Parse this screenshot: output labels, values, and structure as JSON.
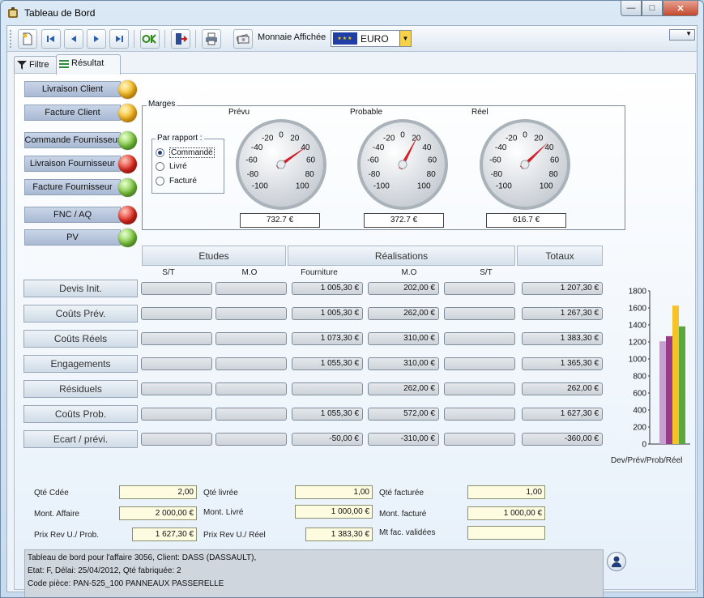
{
  "window": {
    "title": "Tableau de Bord"
  },
  "toolbar": {
    "monnaie_label": "Monnaie Affichée",
    "currency": "EURO",
    "currency_options_icon": "chevron-down-icon"
  },
  "tabs": [
    {
      "label": "Filtre",
      "icon": "filter-icon",
      "active": false
    },
    {
      "label": "Résultat",
      "icon": "list-icon",
      "active": true
    }
  ],
  "status_buttons": [
    {
      "label": "Livraison Client",
      "status": "orange"
    },
    {
      "label": "Facture Client",
      "status": "orange"
    },
    {
      "label": "Commande Fournisseur",
      "status": "green"
    },
    {
      "label": "Livraison Fournisseur",
      "status": "red"
    },
    {
      "label": "Facture Fournisseur",
      "status": "green"
    },
    {
      "label": "FNC / AQ",
      "status": "red"
    },
    {
      "label": "PV",
      "status": "green"
    }
  ],
  "colors": {
    "orange": "#f7b619",
    "green": "#7bc73d",
    "red": "#e1291c",
    "needle": "#d0202a"
  },
  "marges": {
    "title": "Marges",
    "par_rapport_title": "Par rapport :",
    "options": [
      "Commandé",
      "Livré",
      "Facturé"
    ],
    "selected": "Commandé",
    "gauges": [
      {
        "label": "Prévu",
        "value": 732.7,
        "display": "732.7 €"
      },
      {
        "label": "Probable",
        "value": 372.7,
        "display": "372.7 €"
      },
      {
        "label": "Réel",
        "value": 616.7,
        "display": "616.7 €"
      }
    ],
    "scale_labels": [
      "-100",
      "-80",
      "-60",
      "-40",
      "-20",
      "0",
      "20",
      "40",
      "60",
      "80",
      "100"
    ]
  },
  "table": {
    "groups": [
      "Etudes",
      "Réalisations",
      "Totaux"
    ],
    "columns": [
      "S/T",
      "M.O",
      "Fourniture",
      "M.O",
      "S/T"
    ],
    "rows": [
      {
        "label": "Devis Init.",
        "cells": [
          "",
          "",
          "1 005,30 €",
          "202,00 €",
          "",
          "1 207,30 €"
        ]
      },
      {
        "label": "Coûts Prév.",
        "cells": [
          "",
          "",
          "1 005,30 €",
          "262,00 €",
          "",
          "1 267,30 €"
        ]
      },
      {
        "label": "Coûts Réels",
        "cells": [
          "",
          "",
          "1 073,30 €",
          "310,00 €",
          "",
          "1 383,30 €"
        ]
      },
      {
        "label": "Engagements",
        "cells": [
          "",
          "",
          "1 055,30 €",
          "310,00 €",
          "",
          "1 365,30 €"
        ]
      },
      {
        "label": "Résiduels",
        "cells": [
          "",
          "",
          "",
          "262,00 €",
          "",
          "262,00 €"
        ]
      },
      {
        "label": "Coûts Prob.",
        "cells": [
          "",
          "",
          "1 055,30 €",
          "572,00 €",
          "",
          "1 627,30 €"
        ]
      },
      {
        "label": "Ecart / prévi.",
        "cells": [
          "",
          "",
          "-50,00 €",
          "-310,00 €",
          "",
          "-360,00 €"
        ]
      }
    ]
  },
  "chart_data": {
    "type": "bar",
    "categories": [
      "Dev",
      "Prév",
      "Prob",
      "Réel"
    ],
    "values": [
      1207.3,
      1267.3,
      1627.3,
      1383.3
    ],
    "colors": [
      "#c7a0d2",
      "#9a3b8a",
      "#f6c22a",
      "#5aa83a"
    ],
    "xlabel": "Dev/Prév/Prob/Réel",
    "ylim": [
      0,
      1800
    ],
    "yticks": [
      "0",
      "200",
      "400",
      "600",
      "800",
      "1000",
      "1200",
      "1400",
      "1600",
      "1800"
    ]
  },
  "fields": {
    "qte_cdee_label": "Qté Cdée",
    "qte_cdee": "2,00",
    "qte_livree_label": "Qté livrée",
    "qte_livree": "1,00",
    "qte_facturee_label": "Qté facturée",
    "qte_facturee": "1,00",
    "mont_affaire_label": "Mont. Affaire",
    "mont_affaire": "2 000,00 €",
    "mont_livre_label": "Mont.  Livré",
    "mont_livre": "1 000,00 €",
    "mont_facture_label": "Mont.  facturé",
    "mont_facture": "1 000,00 €",
    "prix_prob_label": "Prix Rev U./ Prob.",
    "prix_prob": "1 627,30 €",
    "prix_reel_label": "Prix Rev U./ Réel",
    "prix_reel": "1 383,30 €",
    "mt_fac_label": "Mt fac. validées",
    "mt_fac": ""
  },
  "info": {
    "line1": "Tableau de bord pour l'affaire 3056, Client: DASS (DASSAULT),",
    "line2": "Etat: F, Délai: 25/04/2012, Qté fabriquée: 2",
    "line3": "Code pièce: PAN-525_100 PANNEAUX PASSERELLE"
  }
}
